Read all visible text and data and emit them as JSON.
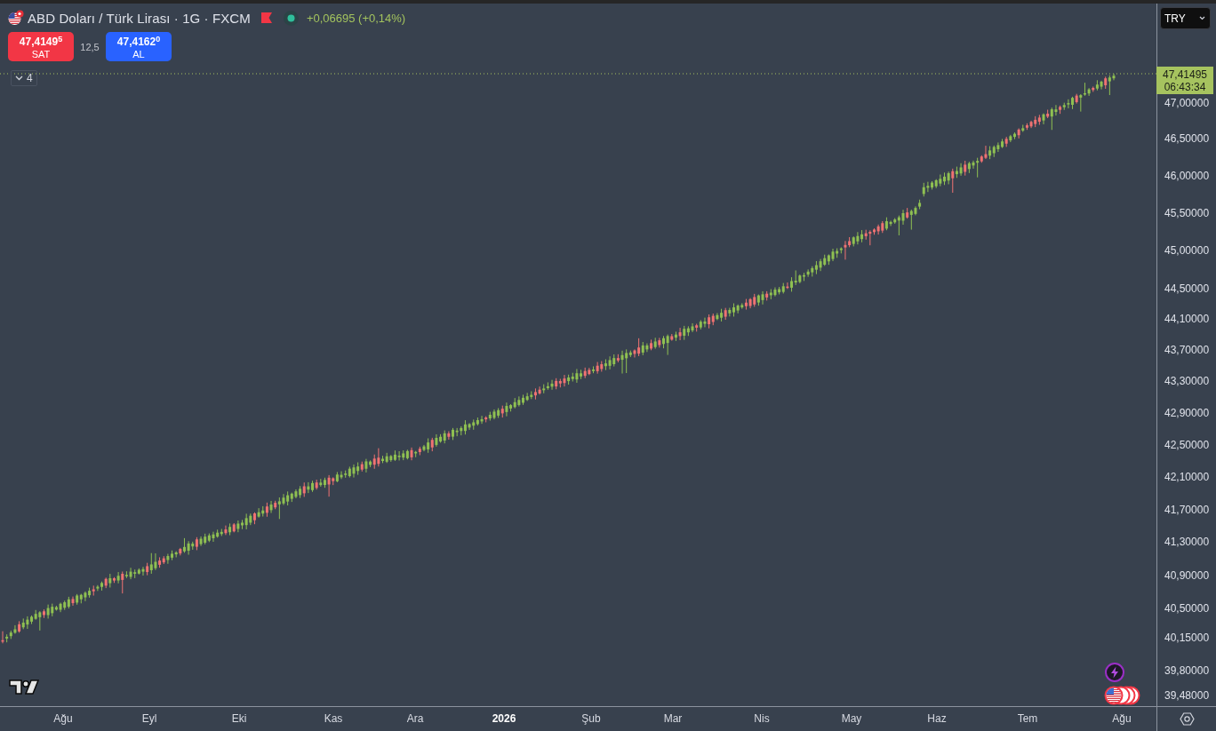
{
  "header": {
    "symbol": "ABD Doları / Türk Lirası · 1G · FXCM",
    "change": "+0,06695 (+0,14%)"
  },
  "trade": {
    "sell": {
      "price": "47,4149$^{5}$",
      "label": "SAT"
    },
    "spread": "12,5",
    "buy": {
      "price": "47,4162$^{0}$",
      "label": "AL"
    }
  },
  "indicators": {
    "count": "4"
  },
  "currency": "TRY",
  "last_price": {
    "price": "47,41495",
    "countdown": "06:43:34"
  },
  "price_axis": [
    "47,00000",
    "46,50000",
    "46,00000",
    "45,50000",
    "45,00000",
    "44,50000",
    "44,10000",
    "43,70000",
    "43,30000",
    "42,90000",
    "42,50000",
    "42,10000",
    "41,70000",
    "41,30000",
    "40,90000",
    "40,50000",
    "40,15000",
    "39,80000",
    "39,48000"
  ],
  "time_axis": [
    {
      "label": "Ağu",
      "kind": "month"
    },
    {
      "label": "Eyl",
      "kind": "month"
    },
    {
      "label": "Eki",
      "kind": "month"
    },
    {
      "label": "Kas",
      "kind": "month"
    },
    {
      "label": "Ara",
      "kind": "month"
    },
    {
      "label": "2026",
      "kind": "year"
    },
    {
      "label": "Şub",
      "kind": "month"
    },
    {
      "label": "Mar",
      "kind": "month"
    },
    {
      "label": "Nis",
      "kind": "month"
    },
    {
      "label": "May",
      "kind": "month"
    },
    {
      "label": "Haz",
      "kind": "month"
    },
    {
      "label": "Tem",
      "kind": "month"
    },
    {
      "label": "Ağu",
      "kind": "month"
    }
  ]
}
